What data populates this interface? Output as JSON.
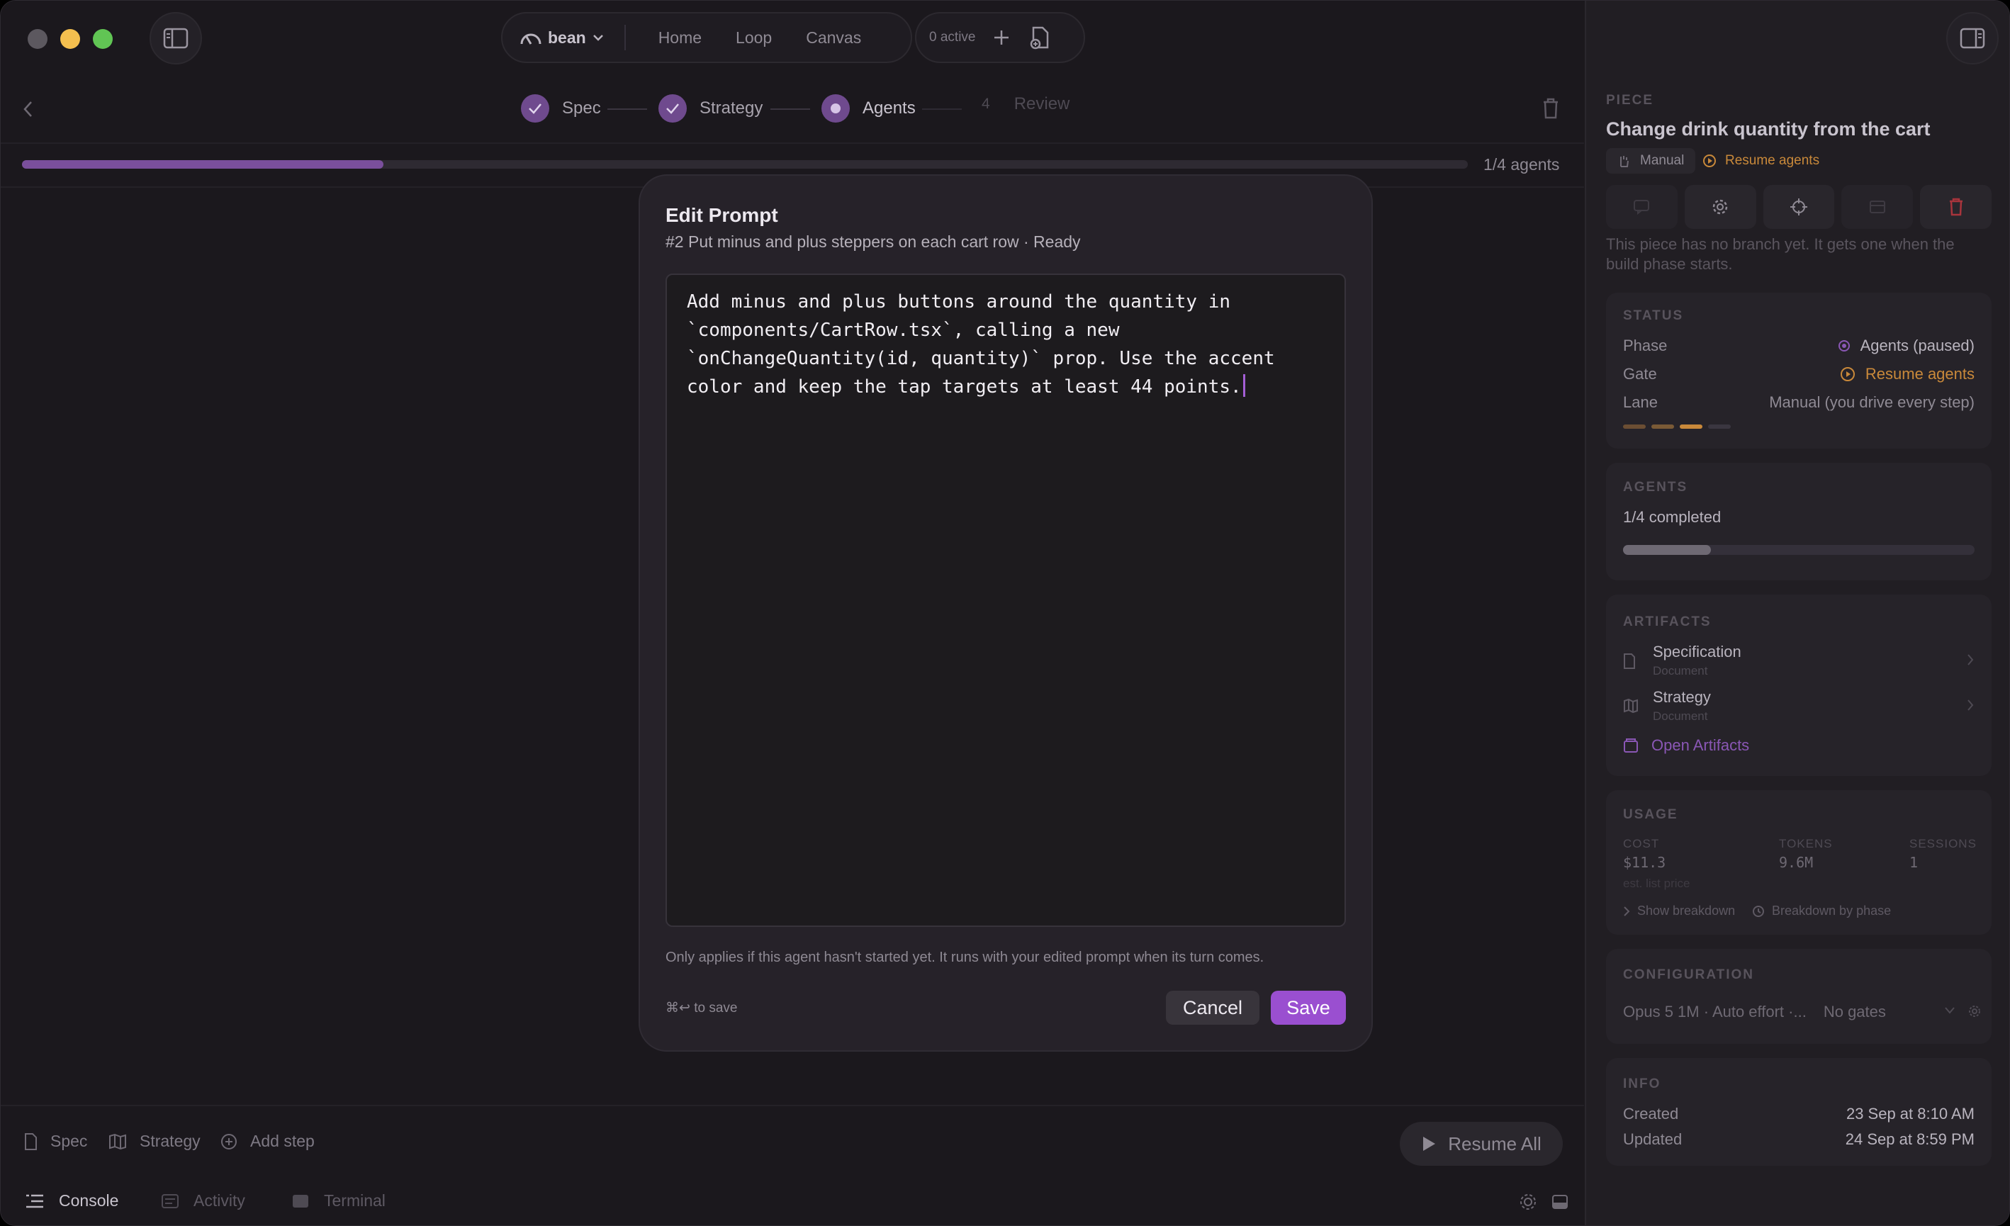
{
  "titlebar": {
    "workspace": "bean",
    "nav": [
      "Home",
      "Loop",
      "Canvas"
    ],
    "active_count": "0 active"
  },
  "stepper": {
    "steps": [
      {
        "label": "Spec",
        "state": "done"
      },
      {
        "label": "Strategy",
        "state": "done"
      },
      {
        "label": "Agents",
        "state": "current"
      },
      {
        "label": "Review",
        "number": "4",
        "state": "pending"
      }
    ]
  },
  "progress": {
    "label": "1/4 agents",
    "fraction": 0.25
  },
  "modal": {
    "title": "Edit Prompt",
    "subtitle": "#2 Put minus and plus steppers on each cart row · Ready",
    "prompt": "Add minus and plus buttons around the quantity in\n`components/CartRow.tsx`, calling a new\n`onChangeQuantity(id, quantity)` prop. Use the accent\ncolor and keep the tap targets at least 44 points.",
    "note": "Only applies if this agent hasn't started yet. It runs with your edited prompt when its turn comes.",
    "shortcut_hint": "⌘↩ to save",
    "cancel_label": "Cancel",
    "save_label": "Save"
  },
  "footer": {
    "spec": "Spec",
    "strategy": "Strategy",
    "add_step": "Add step",
    "resume_all": "Resume All",
    "tabs": [
      "Console",
      "Activity",
      "Terminal"
    ]
  },
  "piece": {
    "label": "PIECE",
    "title": "Change drink quantity from the cart",
    "mode_badge": "Manual",
    "gate_badge": "Resume agents",
    "no_branch_note": "This piece has no branch yet. It gets one when the build phase starts."
  },
  "status": {
    "label": "STATUS",
    "phase_key": "Phase",
    "phase_value": "Agents (paused)",
    "gate_key": "Gate",
    "gate_value": "Resume agents",
    "lane_key": "Lane",
    "lane_value": "Manual (you drive every step)"
  },
  "agents": {
    "label": "AGENTS",
    "completed": "1/4 completed",
    "fraction": 0.25
  },
  "artifacts": {
    "label": "ARTIFACTS",
    "items": [
      {
        "name": "Specification",
        "type": "Document"
      },
      {
        "name": "Strategy",
        "type": "Document"
      }
    ],
    "open_link": "Open Artifacts"
  },
  "usage": {
    "label": "USAGE",
    "cost_label": "COST",
    "cost_value": "$11.3",
    "cost_note": "est. list price",
    "tokens_label": "TOKENS",
    "tokens_value": "9.6M",
    "sessions_label": "SESSIONS",
    "sessions_value": "1",
    "show_breakdown": "Show breakdown",
    "breakdown_by_phase": "Breakdown by phase"
  },
  "configuration": {
    "label": "CONFIGURATION",
    "value": "Opus 5 1M · Auto effort ·...",
    "gates": "No gates"
  },
  "info": {
    "label": "INFO",
    "created_key": "Created",
    "created_value": "23 Sep at 8:10 AM",
    "updated_key": "Updated",
    "updated_value": "24 Sep at 8:59 PM"
  },
  "colors": {
    "accent": "#9a4fd0",
    "warning": "#c9893a",
    "bg": "#1b181d"
  }
}
